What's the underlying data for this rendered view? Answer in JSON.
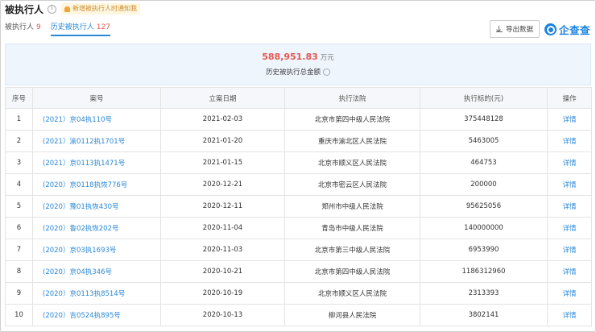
{
  "header": {
    "title": "被执行人",
    "notice": "新增被执行人时通知我"
  },
  "tabs": [
    {
      "label": "被执行人",
      "count": "9"
    },
    {
      "label": "历史被执行人",
      "count": "127"
    }
  ],
  "toolbar": {
    "export_label": "导出数据",
    "logo_text": "企查查"
  },
  "summary": {
    "amount": "588,951.83",
    "unit": "万元",
    "label": "历史被执行总金额"
  },
  "table": {
    "headers": [
      "序号",
      "案号",
      "立案日期",
      "执行法院",
      "执行标的(元)",
      "操作"
    ],
    "rows": [
      {
        "no": "1",
        "case": "(2021）京04执110号",
        "date": "2021-02-03",
        "court": "北京市第四中级人民法院",
        "amount": "375448128",
        "op": "详情"
      },
      {
        "no": "2",
        "case": "(2021）渝0112执1701号",
        "date": "2021-01-20",
        "court": "重庆市渝北区人民法院",
        "amount": "5463005",
        "op": "详情"
      },
      {
        "no": "3",
        "case": "(2021）京0113执1471号",
        "date": "2021-01-15",
        "court": "北京市顺义区人民法院",
        "amount": "464753",
        "op": "详情"
      },
      {
        "no": "4",
        "case": "(2020）京0118执恢776号",
        "date": "2020-12-21",
        "court": "北京市密云区人民法院",
        "amount": "200000",
        "op": "详情"
      },
      {
        "no": "5",
        "case": "(2020）豫01执恢430号",
        "date": "2020-12-11",
        "court": "郑州市中级人民法院",
        "amount": "95625056",
        "op": "详情"
      },
      {
        "no": "6",
        "case": "(2020）鲁02执恢202号",
        "date": "2020-11-04",
        "court": "青岛市中级人民法院",
        "amount": "140000000",
        "op": "详情"
      },
      {
        "no": "7",
        "case": "(2020）京03执1693号",
        "date": "2020-11-03",
        "court": "北京市第三中级人民法院",
        "amount": "6953990",
        "op": "详情"
      },
      {
        "no": "8",
        "case": "(2020）京04执346号",
        "date": "2020-10-21",
        "court": "北京市第四中级人民法院",
        "amount": "1186312960",
        "op": "详情"
      },
      {
        "no": "9",
        "case": "(2020）京0113执8514号",
        "date": "2020-10-19",
        "court": "北京市顺义区人民法院",
        "amount": "2313393",
        "op": "详情"
      },
      {
        "no": "10",
        "case": "(2020）吉0524执895号",
        "date": "2020-10-13",
        "court": "柳河县人民法院",
        "amount": "3802141",
        "op": "详情"
      }
    ]
  }
}
